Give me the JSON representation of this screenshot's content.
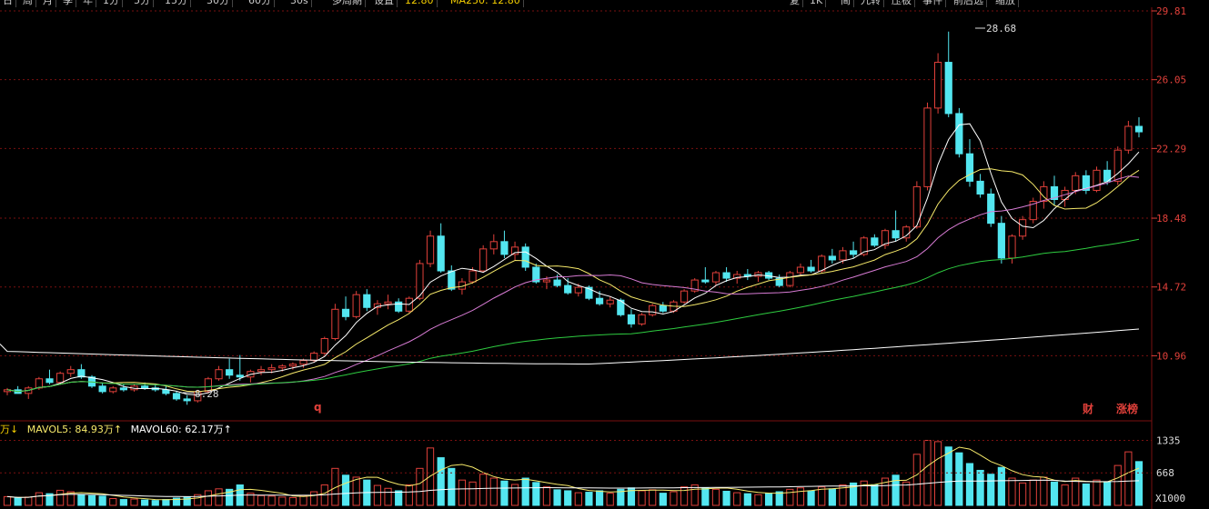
{
  "toolbar": {
    "items": [
      "日",
      "周",
      "月",
      "季",
      "年",
      "1分",
      "5分",
      "15分",
      "30分",
      "60分",
      "30s",
      "多周期",
      "设置"
    ],
    "price_readout": "12.80",
    "ma_readout": "MA250: 12.80",
    "right_items": [
      "复",
      "1K",
      "简",
      "九转",
      "压板",
      "事件",
      "前后选",
      "缩放"
    ]
  },
  "markers": {
    "high_label": "28.68",
    "low_label": "8.28",
    "q_label": "q",
    "cai_label": "财",
    "zhang_label": "涨榜"
  },
  "volume_legend": {
    "vol_unit": "万↓",
    "mavol5": "MAVOL5: 84.93万↑",
    "mavol60": "MAVOL60: 62.17万↑"
  },
  "colors": {
    "up": "#e0403a",
    "down": "#53e6f0",
    "ma5": "#ffffff",
    "ma10": "#f6e96a",
    "ma20": "#d77bd4",
    "ma60": "#2ecc40",
    "ma250": "#ffffff",
    "grid": "#7a1010"
  },
  "chart_data": {
    "type": "candlestick",
    "y_axis": {
      "ticks": [
        "29.81",
        "26.05",
        "22.29",
        "18.48",
        "14.72",
        "10.96"
      ],
      "range": [
        7.8,
        29.81
      ]
    },
    "volume_axis": {
      "ticks": [
        "1335",
        "668"
      ],
      "unit_label": "X1000"
    },
    "candles": [
      [
        9.0,
        9.2,
        8.8,
        9.1,
        180
      ],
      [
        9.1,
        9.3,
        9.0,
        8.9,
        150
      ],
      [
        8.9,
        9.3,
        8.6,
        9.2,
        170
      ],
      [
        9.2,
        9.8,
        9.1,
        9.7,
        260
      ],
      [
        9.7,
        10.2,
        9.4,
        9.5,
        240
      ],
      [
        9.5,
        10.1,
        9.4,
        10.0,
        310
      ],
      [
        10.0,
        10.4,
        9.8,
        10.2,
        280
      ],
      [
        10.2,
        10.5,
        9.7,
        9.8,
        220
      ],
      [
        9.8,
        9.9,
        9.2,
        9.3,
        200
      ],
      [
        9.3,
        9.5,
        8.9,
        9.0,
        190
      ],
      [
        9.0,
        9.3,
        8.9,
        9.2,
        140
      ],
      [
        9.2,
        9.4,
        9.0,
        9.1,
        120
      ],
      [
        9.1,
        9.4,
        9.0,
        9.3,
        130
      ],
      [
        9.3,
        9.5,
        9.1,
        9.2,
        110
      ],
      [
        9.2,
        9.4,
        9.0,
        9.1,
        100
      ],
      [
        9.1,
        9.3,
        8.8,
        8.9,
        120
      ],
      [
        8.9,
        9.0,
        8.5,
        8.6,
        150
      ],
      [
        8.6,
        8.8,
        8.28,
        8.5,
        170
      ],
      [
        8.5,
        9.1,
        8.4,
        9.0,
        220
      ],
      [
        9.0,
        9.8,
        8.9,
        9.7,
        300
      ],
      [
        9.7,
        10.4,
        9.6,
        10.2,
        340
      ],
      [
        10.2,
        10.8,
        9.7,
        9.9,
        330
      ],
      [
        9.9,
        11.0,
        9.6,
        9.8,
        420
      ],
      [
        9.8,
        10.2,
        9.5,
        10.1,
        250
      ],
      [
        10.1,
        10.4,
        9.9,
        10.2,
        200
      ],
      [
        10.2,
        10.5,
        10.0,
        10.3,
        190
      ],
      [
        10.3,
        10.5,
        10.1,
        10.4,
        170
      ],
      [
        10.4,
        10.6,
        10.2,
        10.5,
        160
      ],
      [
        10.5,
        10.8,
        10.3,
        10.7,
        200
      ],
      [
        10.7,
        11.2,
        10.6,
        11.1,
        280
      ],
      [
        11.1,
        12.0,
        11.0,
        11.9,
        420
      ],
      [
        11.9,
        13.8,
        11.8,
        13.5,
        760
      ],
      [
        13.5,
        14.2,
        12.9,
        13.1,
        620
      ],
      [
        13.1,
        14.5,
        13.0,
        14.3,
        580
      ],
      [
        14.3,
        14.6,
        13.4,
        13.6,
        520
      ],
      [
        13.6,
        14.0,
        13.2,
        13.8,
        410
      ],
      [
        13.8,
        14.3,
        13.5,
        13.9,
        350
      ],
      [
        13.9,
        14.1,
        13.3,
        13.4,
        300
      ],
      [
        13.4,
        14.2,
        13.3,
        14.1,
        420
      ],
      [
        14.1,
        16.2,
        14.0,
        16.0,
        760
      ],
      [
        16.0,
        17.8,
        15.8,
        17.5,
        1180
      ],
      [
        17.5,
        18.2,
        15.5,
        15.6,
        980
      ],
      [
        15.6,
        15.9,
        14.5,
        14.6,
        760
      ],
      [
        14.6,
        15.2,
        14.3,
        15.0,
        520
      ],
      [
        15.0,
        15.8,
        14.9,
        15.6,
        480
      ],
      [
        15.6,
        17.0,
        15.5,
        16.8,
        640
      ],
      [
        16.8,
        17.6,
        16.5,
        17.2,
        560
      ],
      [
        17.2,
        17.8,
        16.3,
        16.5,
        500
      ],
      [
        16.5,
        17.2,
        16.2,
        16.9,
        430
      ],
      [
        16.9,
        17.1,
        15.6,
        15.8,
        560
      ],
      [
        15.8,
        16.0,
        14.9,
        15.0,
        470
      ],
      [
        15.0,
        15.3,
        14.6,
        15.1,
        380
      ],
      [
        15.1,
        15.4,
        14.7,
        14.8,
        320
      ],
      [
        14.8,
        15.2,
        14.3,
        14.4,
        300
      ],
      [
        14.4,
        14.9,
        14.2,
        14.7,
        260
      ],
      [
        14.7,
        14.8,
        14.0,
        14.1,
        270
      ],
      [
        14.1,
        14.5,
        13.7,
        13.8,
        300
      ],
      [
        13.8,
        14.2,
        13.6,
        14.0,
        250
      ],
      [
        14.0,
        14.1,
        13.1,
        13.2,
        330
      ],
      [
        13.2,
        13.5,
        12.5,
        12.7,
        360
      ],
      [
        12.7,
        13.3,
        12.6,
        13.2,
        300
      ],
      [
        13.2,
        13.8,
        13.1,
        13.7,
        320
      ],
      [
        13.7,
        13.9,
        13.3,
        13.4,
        250
      ],
      [
        13.4,
        14.0,
        13.3,
        13.9,
        280
      ],
      [
        13.9,
        14.6,
        13.8,
        14.5,
        380
      ],
      [
        14.5,
        15.2,
        14.4,
        15.1,
        420
      ],
      [
        15.1,
        15.8,
        14.9,
        15.0,
        360
      ],
      [
        15.0,
        15.6,
        14.8,
        15.5,
        330
      ],
      [
        15.5,
        15.8,
        15.0,
        15.2,
        290
      ],
      [
        15.2,
        15.6,
        14.9,
        15.4,
        260
      ],
      [
        15.4,
        15.7,
        15.1,
        15.3,
        240
      ],
      [
        15.3,
        15.6,
        15.0,
        15.5,
        220
      ],
      [
        15.5,
        15.6,
        15.1,
        15.2,
        250
      ],
      [
        15.2,
        15.4,
        14.7,
        14.8,
        280
      ],
      [
        14.8,
        15.6,
        14.7,
        15.5,
        330
      ],
      [
        15.5,
        16.0,
        15.3,
        15.8,
        360
      ],
      [
        15.8,
        16.2,
        15.5,
        15.6,
        300
      ],
      [
        15.6,
        16.5,
        15.5,
        16.4,
        380
      ],
      [
        16.4,
        16.8,
        16.0,
        16.2,
        340
      ],
      [
        16.2,
        16.9,
        16.0,
        16.7,
        420
      ],
      [
        16.7,
        17.2,
        16.3,
        16.5,
        460
      ],
      [
        16.5,
        17.5,
        16.4,
        17.4,
        500
      ],
      [
        17.4,
        17.6,
        16.9,
        17.0,
        420
      ],
      [
        17.0,
        17.9,
        16.8,
        17.8,
        560
      ],
      [
        17.8,
        18.9,
        17.2,
        17.4,
        620
      ],
      [
        17.4,
        18.1,
        17.2,
        18.0,
        480
      ],
      [
        18.0,
        20.5,
        17.9,
        20.2,
        1050
      ],
      [
        20.2,
        24.8,
        20.0,
        24.5,
        1335
      ],
      [
        24.5,
        27.5,
        24.2,
        27.0,
        1310
      ],
      [
        27.0,
        28.68,
        24.0,
        24.2,
        1200
      ],
      [
        24.2,
        24.5,
        21.8,
        22.0,
        1080
      ],
      [
        22.0,
        22.8,
        20.2,
        20.5,
        860
      ],
      [
        20.5,
        20.9,
        19.6,
        19.8,
        720
      ],
      [
        19.8,
        20.1,
        18.0,
        18.2,
        640
      ],
      [
        18.2,
        18.6,
        16.0,
        16.3,
        780
      ],
      [
        16.3,
        17.6,
        16.0,
        17.5,
        560
      ],
      [
        17.5,
        18.6,
        17.3,
        18.4,
        460
      ],
      [
        18.4,
        19.6,
        18.2,
        19.4,
        520
      ],
      [
        19.4,
        20.5,
        19.0,
        20.2,
        580
      ],
      [
        20.2,
        20.8,
        19.2,
        19.5,
        480
      ],
      [
        19.5,
        20.2,
        19.1,
        20.0,
        420
      ],
      [
        20.0,
        21.0,
        19.8,
        20.8,
        560
      ],
      [
        20.8,
        21.1,
        19.8,
        20.0,
        440
      ],
      [
        20.0,
        21.3,
        19.9,
        21.1,
        520
      ],
      [
        21.1,
        21.6,
        20.3,
        20.5,
        480
      ],
      [
        20.5,
        22.4,
        20.3,
        22.2,
        820
      ],
      [
        22.2,
        23.8,
        22.0,
        23.5,
        1100
      ],
      [
        23.5,
        24.0,
        22.9,
        23.2,
        900
      ]
    ],
    "ma_series": [
      "MA5",
      "MA10",
      "MA20",
      "MA60",
      "MA250"
    ]
  }
}
